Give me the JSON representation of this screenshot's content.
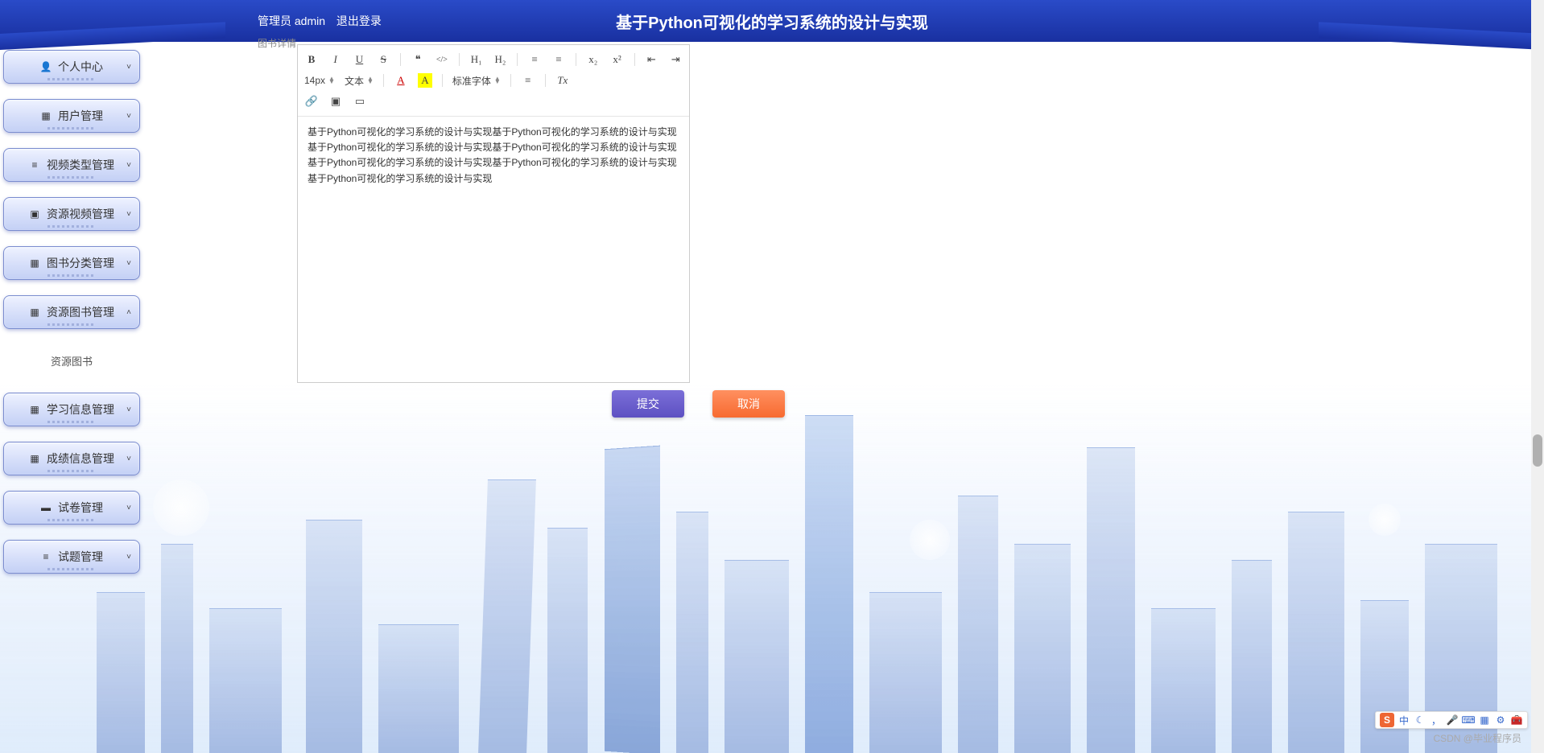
{
  "header": {
    "admin_label": "管理员 admin",
    "logout_label": "退出登录",
    "title": "基于Python可视化的学习系统的设计与实现"
  },
  "sidebar": {
    "items": [
      {
        "icon": "👤",
        "label": "个人中心",
        "chevron": "˅"
      },
      {
        "icon": "▦",
        "label": "用户管理",
        "chevron": "˅"
      },
      {
        "icon": "≡",
        "label": "视频类型管理",
        "chevron": "˅"
      },
      {
        "icon": "▣",
        "label": "资源视频管理",
        "chevron": "˅"
      },
      {
        "icon": "▦",
        "label": "图书分类管理",
        "chevron": "˅"
      },
      {
        "icon": "▦",
        "label": "资源图书管理",
        "chevron": "˄"
      },
      {
        "icon": "▦",
        "label": "学习信息管理",
        "chevron": "˅"
      },
      {
        "icon": "▦",
        "label": "成绩信息管理",
        "chevron": "˅"
      },
      {
        "icon": "▬",
        "label": "试卷管理",
        "chevron": "˅"
      },
      {
        "icon": "≡",
        "label": "试题管理",
        "chevron": "˅"
      }
    ],
    "sub_label": "资源图书"
  },
  "form": {
    "label": "图书详情"
  },
  "editor": {
    "toolbar": {
      "bold": "B",
      "italic": "I",
      "underline": "U",
      "strike": "S",
      "quote": "❝",
      "code": "</>",
      "h1": "H₁",
      "h2": "H₂",
      "ol": "≡",
      "ul": "≡",
      "sub": "x₂",
      "sup": "x²",
      "indent_dec": "⇤",
      "indent_inc": "⇥",
      "size": "14px",
      "para": "文本",
      "font": "标准字体",
      "color": "A",
      "bgcolor": "A",
      "align": "≡",
      "clear": "Tx",
      "link": "🔗",
      "image": "▣",
      "video": "▭"
    },
    "content": "基于Python可视化的学习系统的设计与实现基于Python可视化的学习系统的设计与实现基于Python可视化的学习系统的设计与实现基于Python可视化的学习系统的设计与实现基于Python可视化的学习系统的设计与实现基于Python可视化的学习系统的设计与实现基于Python可视化的学习系统的设计与实现"
  },
  "buttons": {
    "submit": "提交",
    "cancel": "取消"
  },
  "watermark": "CSDN @毕业程序员",
  "tray": {
    "flag": "S",
    "ch": "中"
  }
}
